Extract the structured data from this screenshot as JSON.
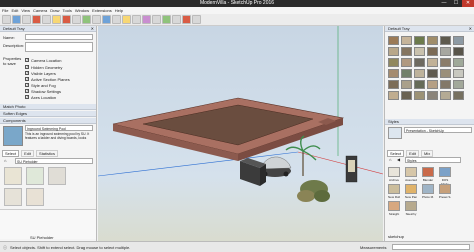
{
  "window": {
    "title": "ModernVilla - SketchUp Pro 2016",
    "minimize": "—",
    "maximize": "☐",
    "close": "✕"
  },
  "menus": [
    "File",
    "Edit",
    "View",
    "Camera",
    "Draw",
    "Tools",
    "Window",
    "Extensions",
    "Help"
  ],
  "left_panel": {
    "tray_title": "Default Tray",
    "name_label": "Name:",
    "description_label": "Description:",
    "properties_label": "Properties to save",
    "checkboxes": [
      "Camera Location",
      "Hidden Geometry",
      "Visible Layers",
      "Active Section Planes",
      "Style and Fog",
      "Shadow Settings",
      "Axes Location"
    ],
    "sections": [
      "Match Photo",
      "Soften Edges",
      "Components"
    ],
    "component_name": "Inground Swimming Pool",
    "component_desc": "This is an inground swimming pool by SU. It features a ladder and diving boards, looks",
    "tabs": [
      "Select",
      "Edit",
      "Statistics"
    ],
    "search_value": "SU Pieholder",
    "footer_label": "SU Pieholder"
  },
  "right_panel": {
    "tray_title": "Default Tray",
    "styles_header": "Styles",
    "style_name": "Presentation - SketchUp",
    "tabs": [
      "Select",
      "Edit",
      "Mix"
    ],
    "dropdown_value": "Styles",
    "style_tiles": [
      "Archive",
      "Assorted",
      "Blender",
      "DOS Mode",
      "New Roll",
      "New Pan",
      "Photo M.",
      "Preset S.",
      "Straight",
      "Sketchy"
    ],
    "footer": "sketchup"
  },
  "status": {
    "hint": "Select objects. Shift to extend select. Drag mouse to select multiple.",
    "measurements_label": "Measurements"
  },
  "colors": {
    "accent": "#2b2b2b",
    "pool_wall": "#a97062",
    "pool_water": "#6a4d3f"
  }
}
